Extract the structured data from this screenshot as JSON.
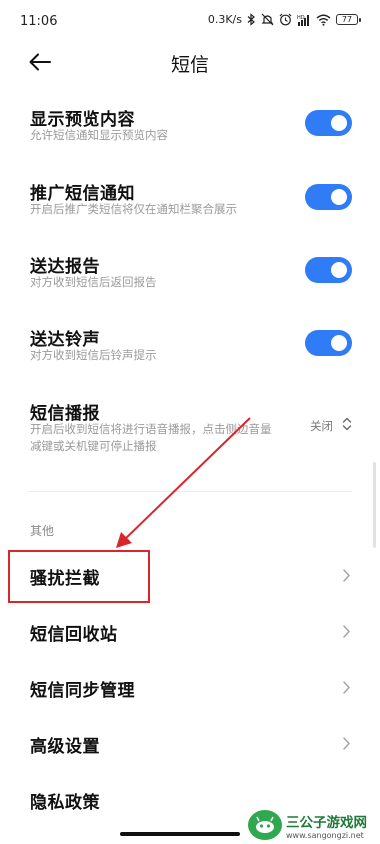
{
  "status_bar": {
    "time": "11:06",
    "net_speed": "0.3K/s",
    "battery": "77",
    "icons": [
      "bluetooth-icon",
      "mute-icon",
      "alarm-icon",
      "hd-signal-icon",
      "wifi-icon",
      "battery-icon"
    ]
  },
  "nav": {
    "back_icon": "back-arrow-icon",
    "title": "短信"
  },
  "toggle_settings": [
    {
      "title": "显示预览内容",
      "subtitle": "允许短信通知显示预览内容",
      "enabled": true
    },
    {
      "title": "推广短信通知",
      "subtitle": "开启后推广类短信将仅在通知栏聚合展示",
      "enabled": true
    },
    {
      "title": "送达报告",
      "subtitle": "对方收到短信后返回报告",
      "enabled": true
    },
    {
      "title": "送达铃声",
      "subtitle": "对方收到短信后铃声提示",
      "enabled": true
    }
  ],
  "broadcast": {
    "title": "短信播报",
    "subtitle_line1": "开启后收到短信将进行语音播报，点击侧边音量",
    "subtitle_line2": "减键或关机键可停止播报",
    "value": "关闭"
  },
  "section": {
    "label": "其他"
  },
  "other_items": [
    {
      "label": "骚扰拦截"
    },
    {
      "label": "短信回收站"
    },
    {
      "label": "短信同步管理"
    },
    {
      "label": "高级设置"
    },
    {
      "label": "隐私政策"
    }
  ],
  "colors": {
    "toggle_on": "#2f7cf6",
    "annotation_red": "#d9262c"
  },
  "watermark": {
    "title": "三公子游戏网",
    "url": "www.sangongzi.net"
  }
}
